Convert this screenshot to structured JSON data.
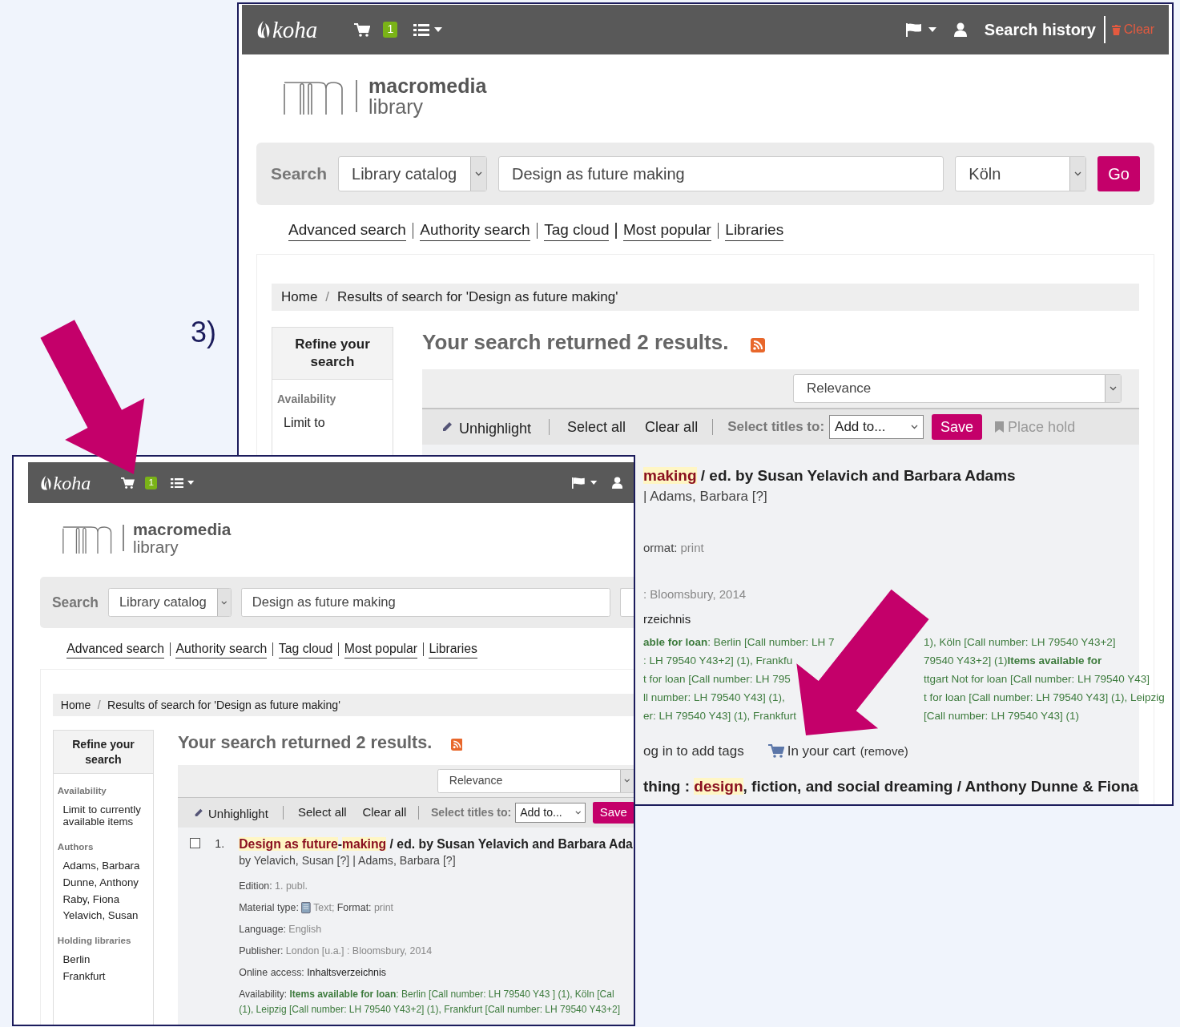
{
  "step_label": "3)",
  "screenshots": [
    {
      "navbar": {
        "brand": "koha",
        "cart_count": "1",
        "search_history": "Search history",
        "clear": "Clear"
      },
      "logo": {
        "name": "macromedia",
        "subtitle": "library"
      },
      "search": {
        "label": "Search",
        "scope": "Library catalog",
        "query": "Design as future making",
        "library": "Köln",
        "go": "Go"
      },
      "links": [
        "Advanced search",
        "Authority search",
        "Tag cloud",
        "Most popular",
        "Libraries"
      ],
      "breadcrumb": {
        "items": [
          "Home",
          "Results of search for 'Design as future making'"
        ],
        "separator": "/"
      },
      "refine": {
        "title": "Refine your search",
        "groups": [
          {
            "heading": "Availability",
            "items": [
              "Limit to"
            ]
          }
        ]
      },
      "heading": "Your search returned 2 results.",
      "sort": "Relevance",
      "toolbar": {
        "unhighlight": "Unhighlight",
        "select_all": "Select all",
        "clear_all": "Clear all",
        "select_titles": "Select titles to:",
        "add_to": "Add to...",
        "save": "Save",
        "place_hold": "Place hold"
      },
      "results": [
        {
          "title_parts": [
            {
              "text": "making",
              "highlighted": true
            },
            {
              "text": " / ed. by Susan Yelavich and Barbara Adams",
              "highlighted": false
            }
          ],
          "authors": "| Adams, Barbara [?]",
          "details": [
            {
              "kind": "plain",
              "label": "ormat:",
              "value": "print"
            },
            {
              "kind": "plain",
              "value": ": Bloomsbury, 2014"
            },
            {
              "kind": "link",
              "value": "rzeichnis"
            },
            {
              "kind": "availability",
              "lines": [
                {
                  "left": "**able for loan**: Berlin [Call number: LH 7",
                  "right": "1), Köln [Call number: LH 79540 Y43+2]"
                },
                {
                  "left": ": LH 79540 Y43+2] (1), Frankfu",
                  "right": "79540 Y43+2] (1)**Items available for**"
                },
                {
                  "left": "t for loan [Call number: LH 795",
                  "right": "ttgart Not for loan [Call number: LH 79540 Y43]"
                },
                {
                  "left": "ll number: LH 79540 Y43] (1),",
                  "right": "t for loan [Call number: LH 79540 Y43] (1), Leipzig"
                },
                {
                  "left": "er: LH 79540 Y43] (1), Frankfurt",
                  "right": "[Call number: LH 79540 Y43] (1)"
                }
              ]
            }
          ],
          "actions": {
            "tags": "og in to add tags",
            "cart": "In your cart",
            "remove": "(remove)"
          }
        },
        {
          "title_parts": [
            {
              "text": "thing : ",
              "highlighted": false
            },
            {
              "text": "design",
              "highlighted": true
            },
            {
              "text": ", fiction, and social dreaming / Anthony Dunne & Fiona",
              "highlighted": false
            }
          ]
        }
      ]
    },
    {
      "navbar": {
        "brand": "koha",
        "cart_count": "1"
      },
      "logo": {
        "name": "macromedia",
        "subtitle": "library"
      },
      "search": {
        "label": "Search",
        "scope": "Library catalog",
        "query": "Design as future making"
      },
      "links": [
        "Advanced search",
        "Authority search",
        "Tag cloud",
        "Most popular",
        "Libraries"
      ],
      "breadcrumb": {
        "items": [
          "Home",
          "Results of search for 'Design as future making'"
        ],
        "separator": "/"
      },
      "refine": {
        "title": "Refine your search",
        "groups": [
          {
            "heading": "Availability",
            "items": [
              "Limit to currently available items"
            ]
          },
          {
            "heading": "Authors",
            "items": [
              "Adams, Barbara",
              "Dunne, Anthony",
              "Raby, Fiona",
              "Yelavich, Susan"
            ]
          },
          {
            "heading": "Holding libraries",
            "items": [
              "Berlin",
              "Frankfurt"
            ]
          }
        ]
      },
      "heading": "Your search returned 2 results.",
      "sort": "Relevance",
      "toolbar": {
        "unhighlight": "Unhighlight",
        "select_all": "Select all",
        "clear_all": "Clear all",
        "select_titles": "Select titles to:",
        "add_to": "Add to...",
        "save": "Save"
      },
      "results": [
        {
          "checked": false,
          "number": "1.",
          "title_parts": [
            {
              "text": "Design as future",
              "highlighted": true
            },
            {
              "text": "-",
              "highlighted": false
            },
            {
              "text": "making",
              "highlighted": true
            },
            {
              "text": " / ed. by Susan Yelavich and Barbara Ada",
              "highlighted": false
            }
          ],
          "authors": "by Yelavich, Susan [?] | Adams, Barbara [?]",
          "details": [
            {
              "kind": "plain",
              "label": "Edition:",
              "value": "1. publ."
            },
            {
              "kind": "material",
              "label": "Material type:",
              "value": "Text;",
              "label_2": "Format:",
              "value_2": "print"
            },
            {
              "kind": "plain",
              "label": "Language:",
              "value": "English"
            },
            {
              "kind": "plain",
              "label": "Publisher:",
              "value": "London [u.a.] : Bloomsbury, 2014"
            },
            {
              "kind": "link",
              "label": "Online access:",
              "value": "Inhaltsverzeichnis"
            },
            {
              "kind": "availability",
              "label": "Availability:",
              "lines": [
                {
                  "left": "**Items available for loan**: Berlin [Call number: LH 79540 Y43 ] (1), Köln [Cal"
                },
                {
                  "left": "(1), Leipzig [Call number: LH 79540 Y43+2] (1), Frankfurt [Call number: LH 79540 Y43+2]"
                }
              ]
            }
          ]
        }
      ]
    }
  ]
}
